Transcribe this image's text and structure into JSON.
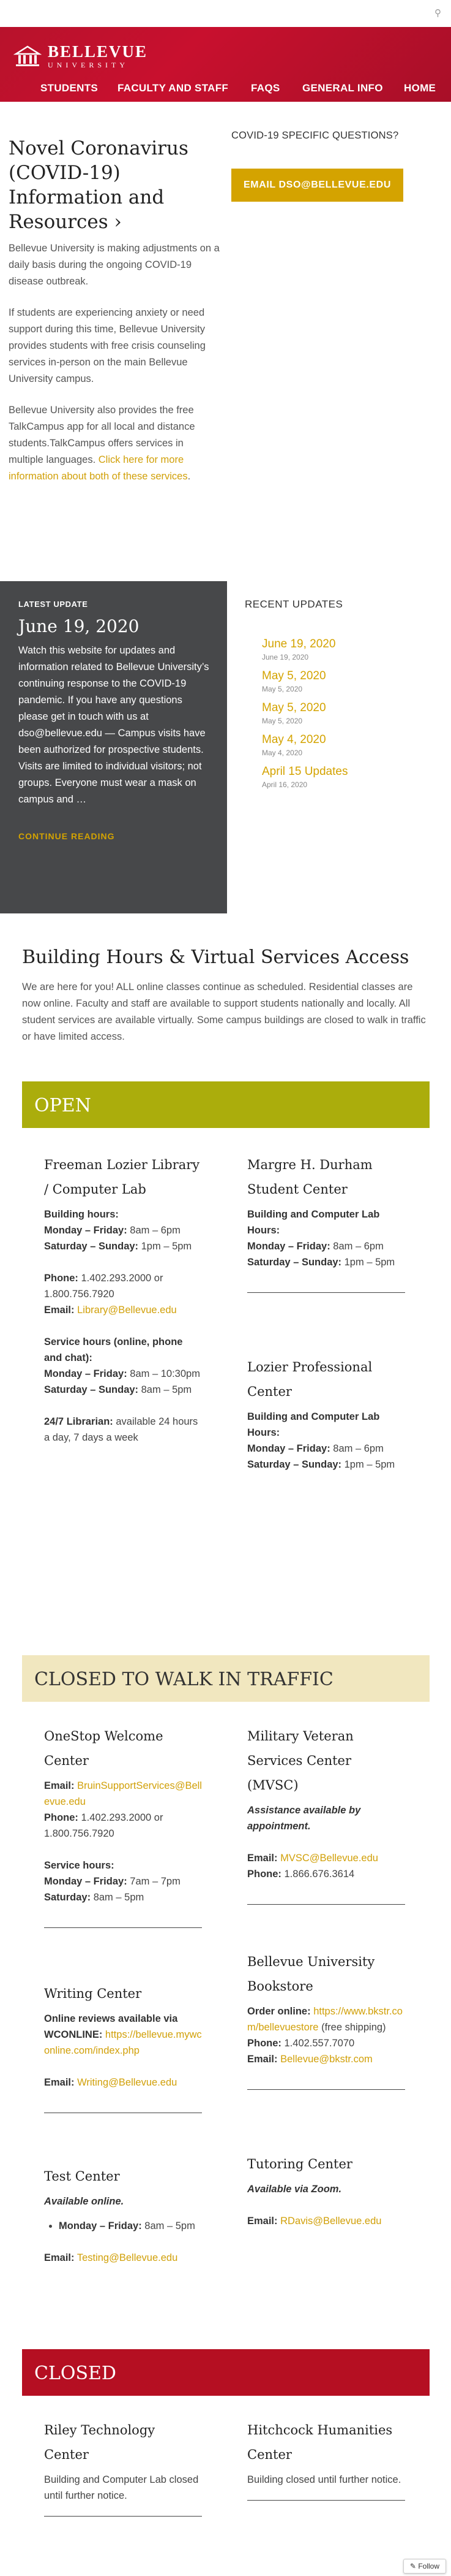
{
  "header": {
    "logo_line1": "BELLEVUE",
    "logo_line2": "UNIVERSITY",
    "nav": [
      "STUDENTS",
      "FACULTY AND STAFF",
      "FAQS",
      "GENERAL INFO",
      "HOME"
    ]
  },
  "intro": {
    "title": "Novel Coronavirus (COVID-19) Information and Resources ›",
    "p1": "Bellevue University is making adjustments on a daily basis during the ongoing COVID-19 disease outbreak.",
    "p2": "If students are experiencing anxiety or need support during this time, Bellevue University provides students with free crisis counseling services in-person on the main Bellevue University campus.",
    "p3": "Bellevue University also provides the free TalkCampus app for all local and distance students.TalkCampus offers services in multiple languages. ",
    "p3_link": "Click here for more information about both of these services",
    "p3_end": "."
  },
  "questions": {
    "label": "COVID-19 SPECIFIC QUESTIONS?",
    "button": "EMAIL DSO@BELLEVUE.EDU"
  },
  "latest": {
    "tag": "LATEST UPDATE",
    "date": "June 19, 2020",
    "text": "Watch this website for updates and information related to Bellevue University’s continuing response to the COVID-19 pandemic. If you have any questions please get in touch with us at dso@bellevue.edu — Campus visits have been authorized for prospective students. Visits are limited to individual visitors; not groups. Everyone must wear a mask on campus and …",
    "continue": "CONTINUE READING"
  },
  "recent": {
    "heading": "RECENT UPDATES",
    "items": [
      {
        "title": "June 19, 2020",
        "date": "June 19, 2020"
      },
      {
        "title": "May 5, 2020",
        "date": "May 5, 2020"
      },
      {
        "title": "May 5, 2020",
        "date": "May 5, 2020"
      },
      {
        "title": "May 4, 2020",
        "date": "May 4, 2020"
      },
      {
        "title": "April 15 Updates",
        "date": "April 16, 2020"
      }
    ]
  },
  "building": {
    "title": "Building Hours & Virtual Services Access",
    "text": "We are here for you! ALL online classes continue as scheduled. Residential classes are now online. Faculty and staff are available to support students nationally and locally. All student services are available virtually. Some campus buildings are closed to walk in traffic or have limited access."
  },
  "bands": {
    "open": "OPEN",
    "walk": "CLOSED TO WALK IN TRAFFIC",
    "closed": "CLOSED"
  },
  "open": {
    "freeman": {
      "name": "Freeman Lozier Library / Computer Lab",
      "bh_label": "Building hours:",
      "mf_label": "Monday – Friday:",
      "mf": " 8am – 6pm",
      "ss_label": "Saturday – Sunday:",
      "ss": " 1pm – 5pm",
      "phone_label": "Phone:",
      "phone": " 1.402.293.2000 or 1.800.756.7920",
      "email_label": "Email:",
      "email": "Library@Bellevue.edu",
      "sh_label": "Service hours (online, phone and chat):",
      "smf_label": "Monday – Friday:",
      "smf": " 8am – 10:30pm",
      "sss_label": "Saturday – Sunday:",
      "sss": " 8am – 5pm",
      "lib_label": "24/7 Librarian:",
      "lib": " available 24 hours a day, 7 days a week"
    },
    "durham": {
      "name": "Margre H. Durham Student Center",
      "label": "Building and Computer Lab Hours:",
      "mf_label": "Monday – Friday:",
      "mf": " 8am – 6pm",
      "ss_label": "Saturday – Sunday:",
      "ss": " 1pm – 5pm"
    },
    "lozier": {
      "name": "Lozier Professional Center",
      "label": "Building and Computer Lab Hours:",
      "mf_label": "Monday – Friday:",
      "mf": " 8am – 6pm",
      "ss_label": "Saturday – Sunday:",
      "ss": " 1pm – 5pm"
    }
  },
  "walk": {
    "onestop": {
      "name": "OneStop Welcome Center",
      "email_label": "Email:",
      "email": "BruinSupportServices@Bellevue.edu",
      "phone_label": "Phone:",
      "phone": " 1.402.293.2000 or 1.800.756.7920",
      "sh_label": "Service hours:",
      "mf_label": "Monday – Friday:",
      "mf": " 7am – 7pm",
      "sat_label": "Saturday:",
      "sat": " 8am – 5pm"
    },
    "writing": {
      "name": "Writing Center",
      "reviews": "Online reviews available via WCONLINE:",
      "link": "https://bellevue.mywconline.com/index.php",
      "email_label": "Email:",
      "email": "Writing@Bellevue.edu"
    },
    "test": {
      "name": "Test Center",
      "note": "Available online.",
      "mf_label": "Monday – Friday:",
      "mf": " 8am – 5pm",
      "email_label": "Email:",
      "email": "Testing@Bellevue.edu"
    },
    "mvsc": {
      "name": "Military Veteran Services Center (MVSC)",
      "note": "Assistance available by appointment.",
      "email_label": "Email:",
      "email": "MVSC@Bellevue.edu",
      "phone_label": "Phone:",
      "phone": " 1.866.676.3614"
    },
    "bookstore": {
      "name": "Bellevue University Bookstore",
      "order_label": "Order online:",
      "order_link": "https://www.bkstr.com/bellevuestore",
      "order_note": " (free shipping)",
      "phone_label": "Phone:",
      "phone": " 1.402.557.7070",
      "email_label": "Email:",
      "email": "Bellevue@bkstr.com"
    },
    "tutoring": {
      "name": "Tutoring Center",
      "note": "Available via Zoom.",
      "email_label": "Email:",
      "email": "RDavis@Bellevue.edu"
    }
  },
  "closed": {
    "riley": {
      "name": "Riley Technology Center",
      "text": "Building and Computer Lab closed until further notice."
    },
    "hitchcock": {
      "name": "Hitchcock Humanities Center",
      "text": "Building closed until further notice."
    }
  },
  "follow": "Follow"
}
